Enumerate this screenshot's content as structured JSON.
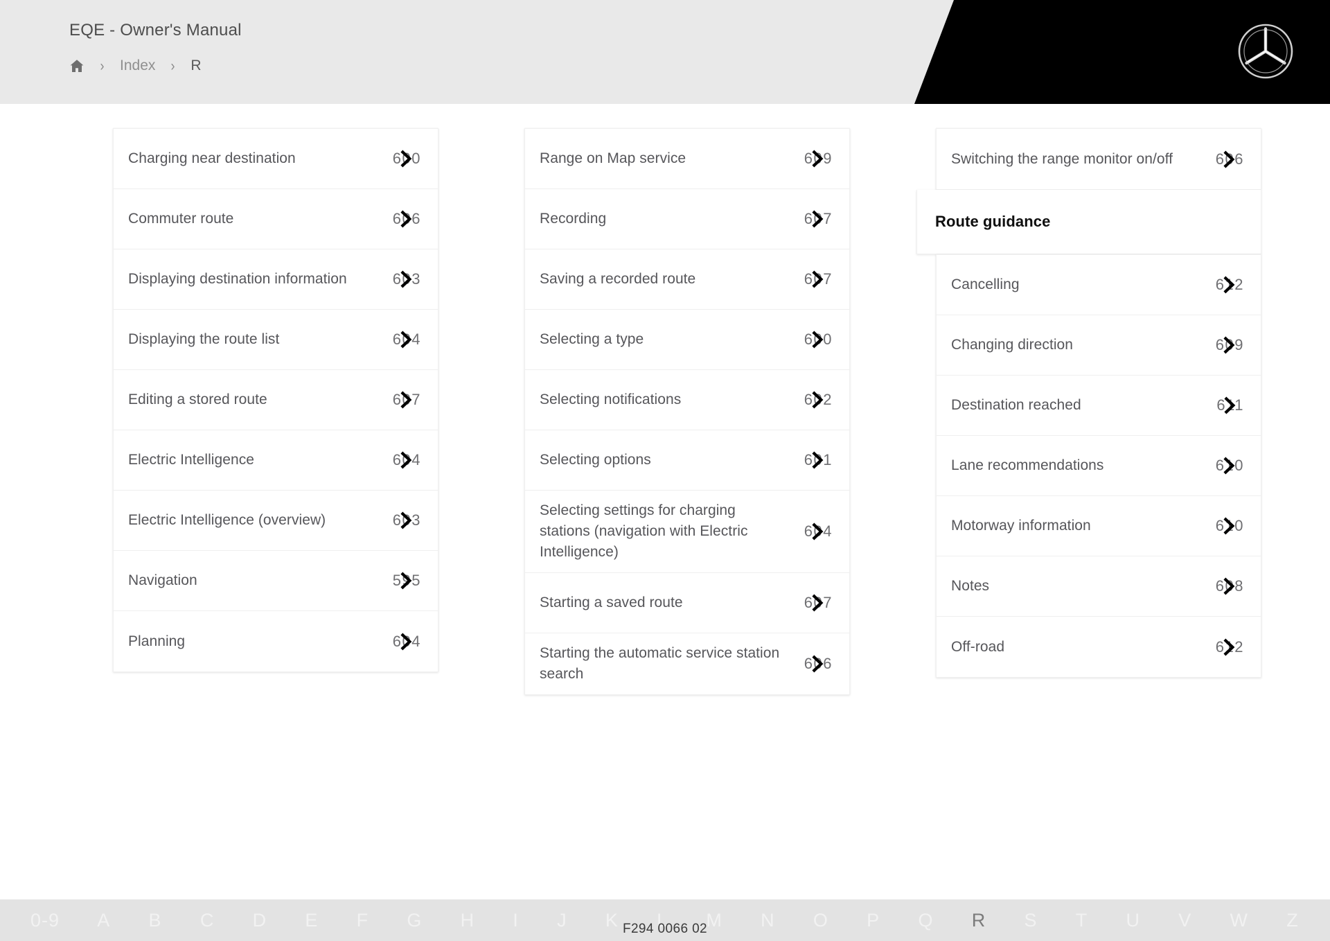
{
  "header": {
    "title": "EQE - Owner's Manual",
    "breadcrumb": {
      "home_icon": "home-icon",
      "separator": "›",
      "index_label": "Index",
      "current_label": "R"
    },
    "brand_logo": "mercedes-benz-star-logo"
  },
  "index": {
    "columns": [
      {
        "blocks": [
          {
            "type": "entries",
            "entries": [
              {
                "label": "Charging near destination",
                "page": "600"
              },
              {
                "label": "Commuter route",
                "page": "606"
              },
              {
                "label": "Displaying destination information",
                "page": "603"
              },
              {
                "label": "Displaying the route list",
                "page": "604"
              },
              {
                "label": "Editing a stored route",
                "page": "607"
              },
              {
                "label": "Electric Intelligence",
                "page": "604"
              },
              {
                "label": "Electric Intelligence (overview)",
                "page": "603"
              },
              {
                "label": "Navigation",
                "page": "595"
              },
              {
                "label": "Planning",
                "page": "604"
              }
            ]
          }
        ]
      },
      {
        "blocks": [
          {
            "type": "entries",
            "entries": [
              {
                "label": "Range on Map service",
                "page": "609"
              },
              {
                "label": "Recording",
                "page": "607"
              },
              {
                "label": "Saving a recorded route",
                "page": "607"
              },
              {
                "label": "Selecting a type",
                "page": "600"
              },
              {
                "label": "Selecting notifications",
                "page": "602"
              },
              {
                "label": "Selecting options",
                "page": "601"
              },
              {
                "label": "Selecting settings for charging stations (navigation with Electric Intelligence)",
                "page": "604"
              },
              {
                "label": "Starting a saved route",
                "page": "607"
              },
              {
                "label": "Starting the automatic service station search",
                "page": "606"
              }
            ]
          }
        ]
      },
      {
        "blocks": [
          {
            "type": "entries",
            "entries": [
              {
                "label": "Switching the range monitor on/off",
                "page": "606"
              }
            ]
          },
          {
            "type": "heading",
            "label": "Route guidance"
          },
          {
            "type": "entries",
            "entries": [
              {
                "label": "Cancelling",
                "page": "612"
              },
              {
                "label": "Changing direction",
                "page": "609"
              },
              {
                "label": "Destination reached",
                "page": "611"
              },
              {
                "label": "Lane recommendations",
                "page": "610"
              },
              {
                "label": "Motorway information",
                "page": "610"
              },
              {
                "label": "Notes",
                "page": "608"
              },
              {
                "label": "Off-road",
                "page": "612"
              }
            ]
          }
        ]
      }
    ]
  },
  "footer": {
    "alphabet": [
      "0-9",
      "A",
      "B",
      "C",
      "D",
      "E",
      "F",
      "G",
      "H",
      "I",
      "J",
      "K",
      "L",
      "M",
      "N",
      "O",
      "P",
      "Q",
      "R",
      "S",
      "T",
      "U",
      "V",
      "W",
      "Z"
    ],
    "active_letter": "R",
    "document_code": "F294 0066 02"
  },
  "colors": {
    "header_bg": "#e9e9e9",
    "header_accent": "#000000",
    "page_bg": "#ffffff",
    "text": "#56565a",
    "heading": "#0f0f0f",
    "footer_bg": "#e3e3e3",
    "footer_letter": "#f2f2f2",
    "footer_letter_active": "#7b7b7b"
  }
}
